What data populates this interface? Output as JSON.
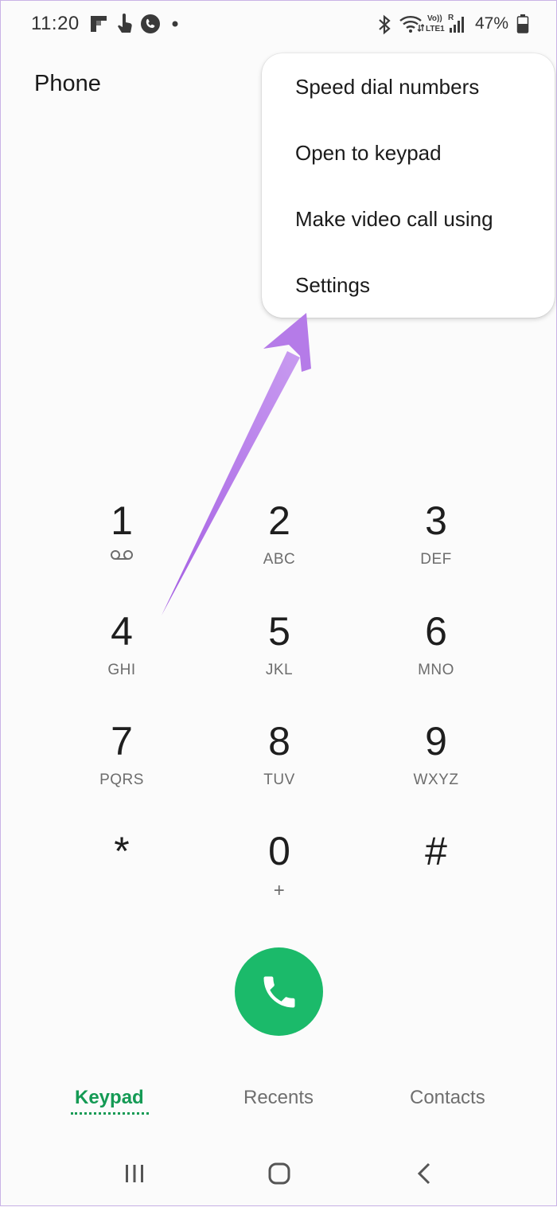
{
  "status_bar": {
    "time": "11:20",
    "battery_percent": "47%",
    "icons": [
      "flipboard-icon",
      "touch-icon",
      "call-active-icon",
      "notification-dot-icon",
      "bluetooth-icon",
      "wifi-icon",
      "volte-icon",
      "signal-icon",
      "battery-icon"
    ]
  },
  "header": {
    "title": "Phone"
  },
  "menu": {
    "items": [
      {
        "label": "Speed dial numbers"
      },
      {
        "label": "Open to keypad"
      },
      {
        "label": "Make video call using"
      },
      {
        "label": "Settings"
      }
    ]
  },
  "keypad": {
    "keys": [
      {
        "digit": "1",
        "letters": "",
        "icon": "voicemail-icon"
      },
      {
        "digit": "2",
        "letters": "ABC"
      },
      {
        "digit": "3",
        "letters": "DEF"
      },
      {
        "digit": "4",
        "letters": "GHI"
      },
      {
        "digit": "5",
        "letters": "JKL"
      },
      {
        "digit": "6",
        "letters": "MNO"
      },
      {
        "digit": "7",
        "letters": "PQRS"
      },
      {
        "digit": "8",
        "letters": "TUV"
      },
      {
        "digit": "9",
        "letters": "WXYZ"
      },
      {
        "digit": "*",
        "letters": ""
      },
      {
        "digit": "0",
        "letters": "+"
      },
      {
        "digit": "#",
        "letters": ""
      }
    ]
  },
  "call_button": {
    "icon": "phone-icon",
    "color": "#1bba6a"
  },
  "tabs": [
    {
      "label": "Keypad",
      "active": true
    },
    {
      "label": "Recents",
      "active": false
    },
    {
      "label": "Contacts",
      "active": false
    }
  ],
  "navigation_bar": {
    "icons": [
      "recent-apps-icon",
      "home-icon",
      "back-icon"
    ]
  },
  "colors": {
    "accent": "#149a54",
    "annotation_arrow": "#b57be8"
  }
}
